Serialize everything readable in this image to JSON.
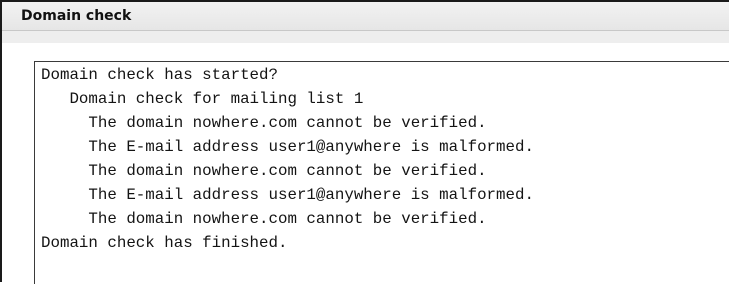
{
  "panel": {
    "title": "Domain check"
  },
  "log": {
    "lines": [
      "Domain check has started?",
      "   Domain check for mailing list 1",
      "     The domain nowhere.com cannot be verified.",
      "     The E-mail address user1@anywhere is malformed.",
      "     The domain nowhere.com cannot be verified.",
      "     The E-mail address user1@anywhere is malformed.",
      "     The domain nowhere.com cannot be verified.",
      "Domain check has finished."
    ]
  }
}
